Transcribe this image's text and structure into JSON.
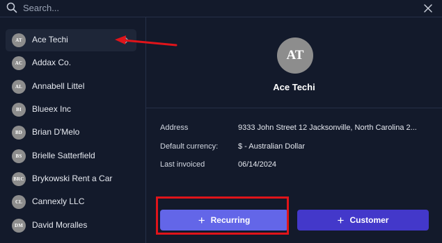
{
  "search": {
    "placeholder": "Search..."
  },
  "sidebar": {
    "items": [
      {
        "initials": "AT",
        "name": "Ace Techi",
        "selected": true
      },
      {
        "initials": "AC",
        "name": "Addax Co.",
        "selected": false
      },
      {
        "initials": "AL",
        "name": "Annabell Littel",
        "selected": false
      },
      {
        "initials": "BI",
        "name": "Blueex Inc",
        "selected": false
      },
      {
        "initials": "BD",
        "name": "Brian D'Melo",
        "selected": false
      },
      {
        "initials": "BS",
        "name": "Brielle Satterfield",
        "selected": false
      },
      {
        "initials": "BRC",
        "name": "Brykowski Rent a Car",
        "selected": false
      },
      {
        "initials": "CL",
        "name": "Cannexly LLC",
        "selected": false
      },
      {
        "initials": "DM",
        "name": "David Moralles",
        "selected": false
      }
    ]
  },
  "detail": {
    "initials": "AT",
    "name": "Ace Techi",
    "fields": [
      {
        "label": "Address",
        "value": "9333 John Street 12 Jacksonville, North Carolina 2..."
      },
      {
        "label": "Default currency:",
        "value": "$ - Australian Dollar"
      },
      {
        "label": "Last invoiced",
        "value": "06/14/2024"
      }
    ]
  },
  "actions": {
    "recurring_label": "Recurring",
    "customer_label": "Customer"
  },
  "colors": {
    "background": "#131a2b",
    "selected_row": "#1e2638",
    "avatar": "#8d8d8d",
    "recurring_button": "#6366e8",
    "customer_button": "#4338ca",
    "annotation": "#e0141a"
  },
  "icons": {
    "search": "search-icon",
    "close": "close-icon",
    "chevron": "chevron-right-icon",
    "plus": "plus-icon"
  }
}
